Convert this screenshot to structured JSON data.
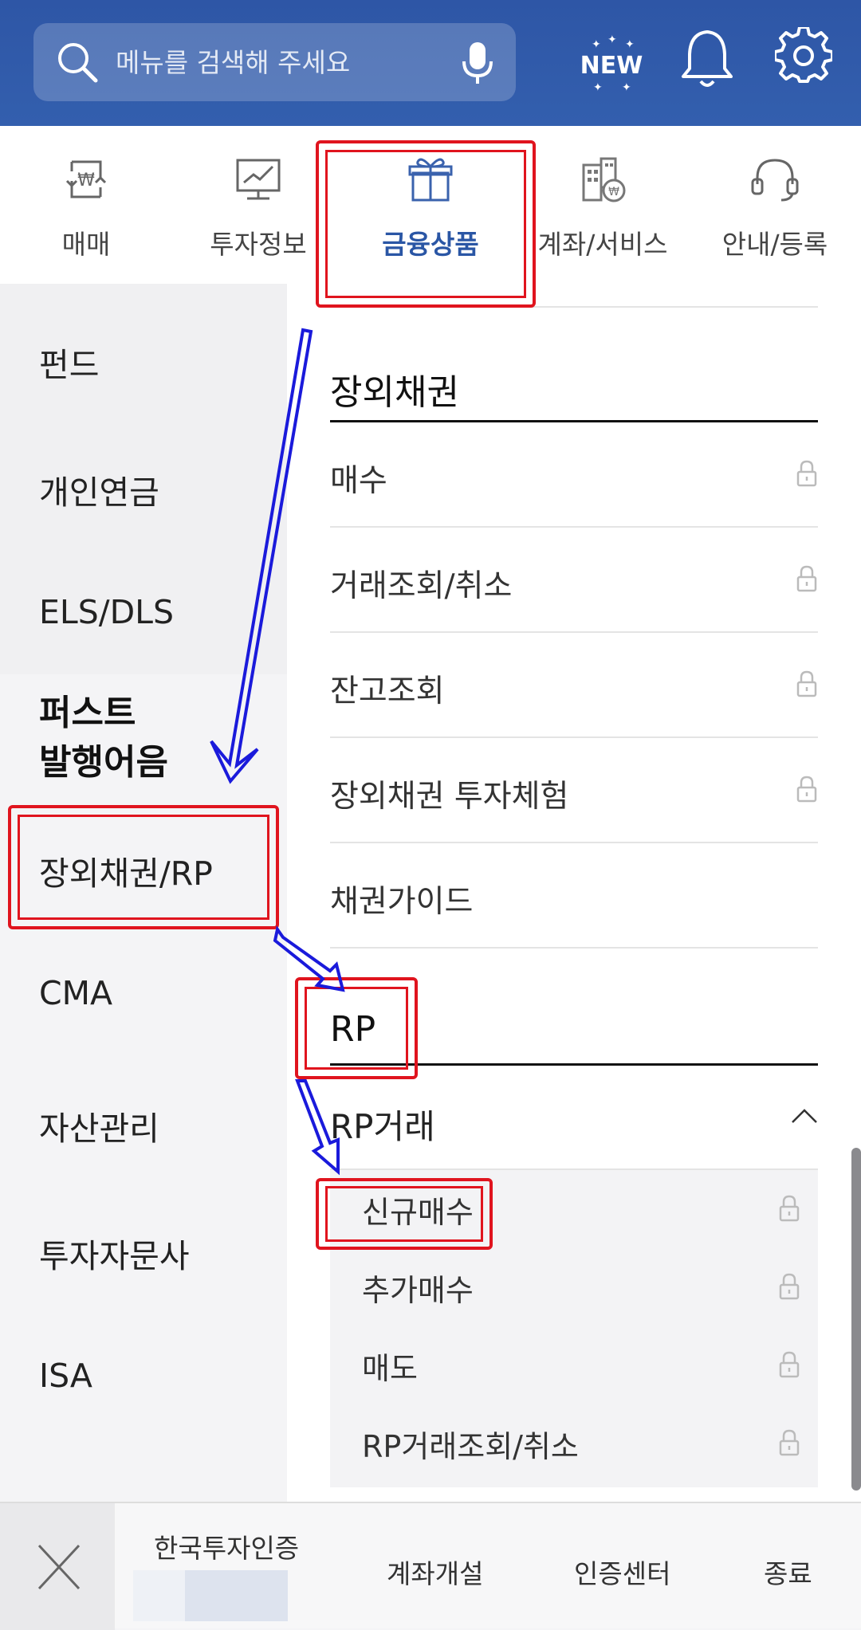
{
  "search": {
    "placeholder": "메뉴를 검색해 주세요"
  },
  "header": {
    "new_badge": "NEW"
  },
  "tabs": [
    {
      "label": "매매",
      "icon": "won-exchange-icon"
    },
    {
      "label": "투자정보",
      "icon": "chart-monitor-icon"
    },
    {
      "label": "금융상품",
      "icon": "gift-icon"
    },
    {
      "label": "계좌/서비스",
      "icon": "building-won-icon"
    },
    {
      "label": "안내/등록",
      "icon": "headset-icon"
    }
  ],
  "sidebar": {
    "items": [
      "펀드",
      "개인연금",
      "ELS/DLS",
      "퍼스트\n발행어음",
      "장외채권/RP",
      "CMA",
      "자산관리",
      "투자자문사",
      "ISA"
    ]
  },
  "content": {
    "section1": {
      "title": "장외채권",
      "rows": [
        "매수",
        "거래조회/취소",
        "잔고조회",
        "장외채권 투자체험",
        "채권가이드"
      ]
    },
    "section2": {
      "title": "RP",
      "group_label": "RP거래",
      "sub_rows": [
        "신규매수",
        "추가매수",
        "매도",
        "RP거래조회/취소"
      ]
    }
  },
  "bottom": {
    "cert": "한국투자인증",
    "account_open": "계좌개설",
    "cert_center": "인증센터",
    "exit": "종료"
  },
  "colors": {
    "header_blue": "#2f59a8",
    "active_tab": "#2a56a5",
    "highlight_red": "#e0141e",
    "arrow_blue": "#1a1adb"
  }
}
